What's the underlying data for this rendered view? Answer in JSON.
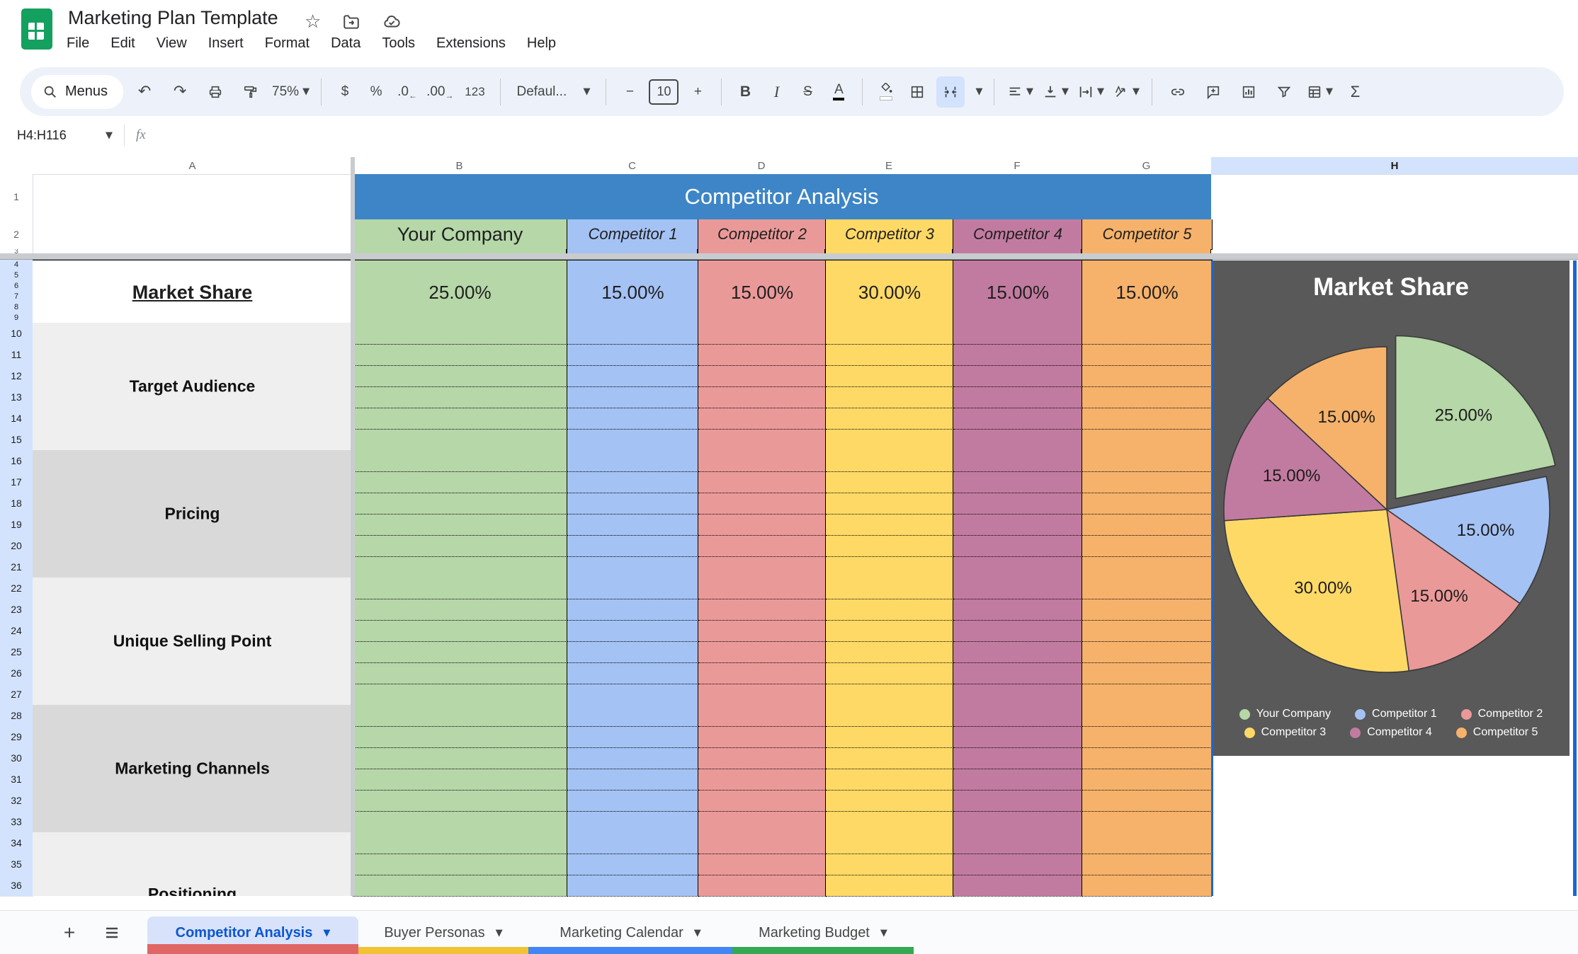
{
  "header": {
    "title": "Marketing Plan Template",
    "menus": [
      "File",
      "Edit",
      "View",
      "Insert",
      "Format",
      "Data",
      "Tools",
      "Extensions",
      "Help"
    ]
  },
  "toolbar": {
    "menus_label": "Menus",
    "undo": "↶",
    "redo": "↷",
    "zoom_value": "75%",
    "currency": "$",
    "percent": "%",
    "decrease_decimal": ".0",
    "increase_decimal": ".00",
    "more_formats": "123",
    "font_name": "Defaul...",
    "decrease_font": "−",
    "font_size": "10",
    "increase_font": "+",
    "bold": "B",
    "italic": "I",
    "strikethrough": "S",
    "text_color": "A",
    "functions": "Σ"
  },
  "formula_bar": {
    "name_box_value": "H4:H116",
    "fx_label": "fx"
  },
  "grid": {
    "column_letters": [
      "A",
      "B",
      "C",
      "D",
      "E",
      "F",
      "G",
      "H"
    ],
    "selected_column": "H",
    "row_numbers_frozen": [
      "1",
      "2",
      "3"
    ],
    "row_numbers_merged": [
      "4",
      "5",
      "6",
      "7",
      "8",
      "9"
    ],
    "row_numbers_body": [
      "10",
      "11",
      "12",
      "13",
      "14",
      "15",
      "16",
      "17",
      "18",
      "19",
      "20",
      "21",
      "22",
      "23",
      "24",
      "25",
      "26",
      "27",
      "28",
      "29",
      "30",
      "31",
      "32",
      "33",
      "34",
      "35",
      "36"
    ],
    "banner": "Competitor Analysis",
    "series_columns": [
      {
        "header": "Your Company",
        "color": "#b6d7a8",
        "italic": false
      },
      {
        "header": "Competitor 1",
        "color": "#a4c2f4",
        "italic": true
      },
      {
        "header": "Competitor 2",
        "color": "#ea9999",
        "italic": true
      },
      {
        "header": "Competitor 3",
        "color": "#ffd966",
        "italic": true
      },
      {
        "header": "Competitor 4",
        "color": "#c27ba0",
        "italic": true
      },
      {
        "header": "Competitor 5",
        "color": "#f6b26b",
        "italic": true
      }
    ],
    "market_share_row": {
      "label": "Market Share",
      "values": [
        "25.00%",
        "15.00%",
        "15.00%",
        "30.00%",
        "15.00%",
        "15.00%"
      ]
    },
    "row_groups": [
      {
        "label": "Target Audience",
        "bg": "#efefef",
        "visible_rows": 6,
        "clipped": false
      },
      {
        "label": "Pricing",
        "bg": "#d9d9d9",
        "visible_rows": 6,
        "clipped": false
      },
      {
        "label": "Unique Selling Point",
        "bg": "#efefef",
        "visible_rows": 6,
        "clipped": false
      },
      {
        "label": "Marketing Channels",
        "bg": "#d9d9d9",
        "visible_rows": 6,
        "clipped": false
      },
      {
        "label": "Positioning",
        "bg": "#efefef",
        "visible_rows": 3,
        "clipped": true
      }
    ]
  },
  "chart_data": {
    "type": "pie",
    "title": "Market Share",
    "categories": [
      "Your Company",
      "Competitor 1",
      "Competitor 2",
      "Competitor 3",
      "Competitor 4",
      "Competitor 5"
    ],
    "values": [
      25,
      15,
      15,
      30,
      15,
      15
    ],
    "labels": [
      "25.00%",
      "15.00%",
      "15.00%",
      "30.00%",
      "15.00%",
      "15.00%"
    ],
    "colors": [
      "#b6d7a8",
      "#a4c2f4",
      "#ea9999",
      "#ffd966",
      "#c27ba0",
      "#f6b26b"
    ],
    "exploded_index": 0,
    "background": "#595959",
    "legend_position": "bottom"
  },
  "sheet_bar": {
    "tabs": [
      {
        "label": "Competitor Analysis",
        "active": true,
        "stripe": "#e06666"
      },
      {
        "label": "Buyer Personas",
        "active": false,
        "stripe": "#f1c232"
      },
      {
        "label": "Marketing Calendar",
        "active": false,
        "stripe": "#4285f4"
      },
      {
        "label": "Marketing Budget",
        "active": false,
        "stripe": "#34a853"
      }
    ]
  }
}
